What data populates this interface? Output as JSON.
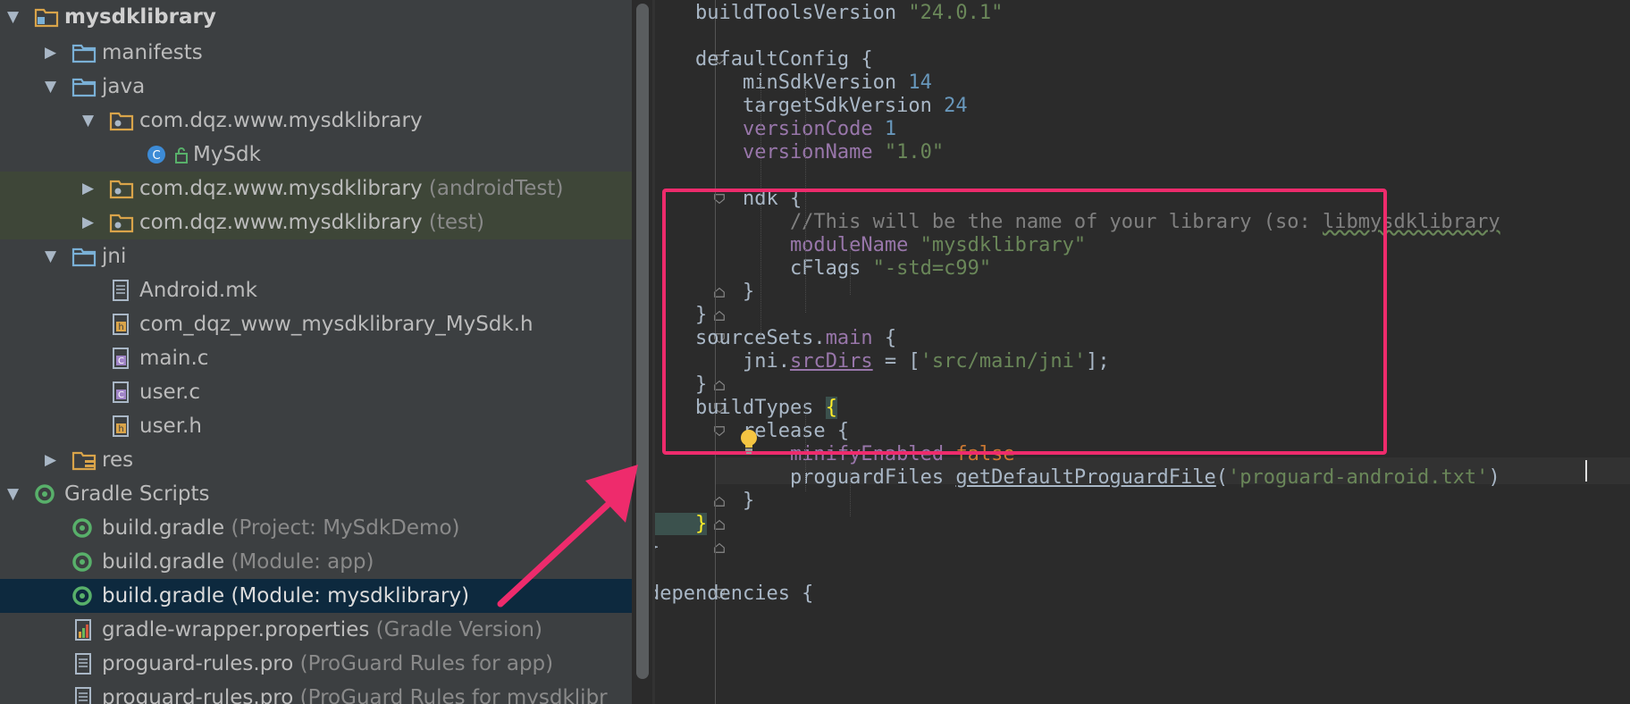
{
  "project_tree": {
    "items": [
      {
        "label": "mysdklibrary",
        "suffix": "",
        "icon": "module-folder-icon",
        "expanded": true
      },
      {
        "label": "manifests",
        "suffix": "",
        "icon": "folder-icon",
        "expanded": false
      },
      {
        "label": "java",
        "suffix": "",
        "icon": "folder-icon",
        "expanded": true
      },
      {
        "label": "com.dqz.www.mysdklibrary",
        "suffix": "",
        "icon": "package-icon",
        "expanded": true
      },
      {
        "label": "MySdk",
        "suffix": "",
        "icon": "class-icon"
      },
      {
        "label": "com.dqz.www.mysdklibrary",
        "suffix": " (androidTest)",
        "icon": "package-icon",
        "expanded": false
      },
      {
        "label": "com.dqz.www.mysdklibrary",
        "suffix": " (test)",
        "icon": "package-icon",
        "expanded": false
      },
      {
        "label": "jni",
        "suffix": "",
        "icon": "folder-icon",
        "expanded": true
      },
      {
        "label": "Android.mk",
        "suffix": "",
        "icon": "text-file-icon"
      },
      {
        "label": "com_dqz_www_mysdklibrary_MySdk.h",
        "suffix": "",
        "icon": "h-file-icon"
      },
      {
        "label": "main.c",
        "suffix": "",
        "icon": "c-file-icon"
      },
      {
        "label": "user.c",
        "suffix": "",
        "icon": "c-file-icon"
      },
      {
        "label": "user.h",
        "suffix": "",
        "icon": "h-file-icon"
      },
      {
        "label": "res",
        "suffix": "",
        "icon": "res-folder-icon",
        "expanded": false
      },
      {
        "label": "Gradle Scripts",
        "suffix": "",
        "icon": "gradle-icon",
        "expanded": true
      },
      {
        "label": "build.gradle",
        "suffix": " (Project: MySdkDemo)",
        "icon": "gradle-icon"
      },
      {
        "label": "build.gradle",
        "suffix": " (Module: app)",
        "icon": "gradle-icon"
      },
      {
        "label": "build.gradle",
        "suffix": " (Module: mysdklibrary)",
        "icon": "gradle-icon",
        "selected": true
      },
      {
        "label": "gradle-wrapper.properties",
        "suffix": " (Gradle Version)",
        "icon": "properties-file-icon"
      },
      {
        "label": "proguard-rules.pro",
        "suffix": " (ProGuard Rules for app)",
        "icon": "text-file-icon"
      },
      {
        "label": "proguard-rules.pro",
        "suffix": " (ProGuard Rules for mysdklibr",
        "icon": "text-file-icon"
      }
    ],
    "class_badge_letter": "C",
    "h_badge_letter": "h",
    "c_badge_letter": "C"
  },
  "editor": {
    "lines": [
      [
        [
          "",
          "    buildToolsVersion "
        ],
        [
          "s",
          "\"24.0.1\""
        ]
      ],
      [],
      [
        [
          "",
          "    defaultConfig {"
        ]
      ],
      [
        [
          "",
          "        minSdkVersion "
        ],
        [
          "n",
          "14"
        ]
      ],
      [
        [
          "",
          "        targetSdkVersion "
        ],
        [
          "n",
          "24"
        ]
      ],
      [
        [
          "p",
          "        versionCode "
        ],
        [
          "n",
          "1"
        ]
      ],
      [
        [
          "p",
          "        versionName "
        ],
        [
          "s",
          "\"1.0\""
        ]
      ],
      [],
      [
        [
          "",
          "        ndk {"
        ]
      ],
      [
        [
          "c",
          "            //This will be the name of your library (so: "
        ],
        [
          "cw",
          "libmysdklibrary"
        ]
      ],
      [
        [
          "p",
          "            moduleName "
        ],
        [
          "s",
          "\"mysdklibrary\""
        ]
      ],
      [
        [
          "",
          "            cFlags "
        ],
        [
          "s",
          "\"-std=c99\""
        ]
      ],
      [
        [
          "",
          "        }"
        ]
      ],
      [
        [
          "",
          "    }"
        ]
      ],
      [
        [
          "",
          "    sourceSets."
        ],
        [
          "p",
          "main"
        ],
        [
          "",
          " {"
        ]
      ],
      [
        [
          "",
          "        jni."
        ],
        [
          "pu",
          "srcDirs"
        ],
        [
          "",
          " = ["
        ],
        [
          "s",
          "'src/main/jni'"
        ],
        [
          "",
          "];"
        ]
      ],
      [
        [
          "",
          "    }"
        ]
      ],
      [
        [
          "",
          "    buildTypes "
        ],
        [
          "hl",
          "{"
        ]
      ],
      [
        [
          "",
          "        release {"
        ]
      ],
      [
        [
          "p",
          "            minifyEnabled "
        ],
        [
          "k",
          "false"
        ]
      ],
      [
        [
          "",
          "            proguardFiles "
        ],
        [
          "u",
          "getDefaultProguardFile"
        ],
        [
          "",
          "("
        ],
        [
          "s",
          "'proguard-android.txt'"
        ],
        [
          "",
          ")"
        ]
      ],
      [
        [
          "",
          "        }"
        ]
      ],
      [
        [
          "hl",
          "    }"
        ]
      ],
      [
        [
          "",
          "}"
        ]
      ],
      [],
      [
        [
          "",
          "dependencies {"
        ]
      ],
      [
        [
          "",
          "        "
        ],
        [
          "c",
          "                                                   "
        ]
      ]
    ]
  },
  "colors": {
    "highlight_box": "#ee2b6c",
    "arrow": "#ee2b6c",
    "selection": "#0d293e"
  }
}
